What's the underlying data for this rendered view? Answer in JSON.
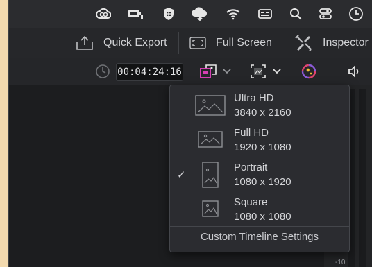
{
  "toolbar": {
    "quick_export": "Quick Export",
    "full_screen": "Full Screen",
    "inspector": "Inspector"
  },
  "viewer": {
    "timecode": "00:04:24:16",
    "meter_label": "-10"
  },
  "menu": {
    "items": [
      {
        "name": "Ultra HD",
        "resolution": "3840 x 2160",
        "checked": false
      },
      {
        "name": "Full HD",
        "resolution": "1920 x 1080",
        "checked": false
      },
      {
        "name": "Portrait",
        "resolution": "1080 x 1920",
        "checked": true
      },
      {
        "name": "Square",
        "resolution": "1080 x 1080",
        "checked": false
      }
    ],
    "checkmark": "✓",
    "custom": "Custom Timeline Settings"
  },
  "colors": {
    "accent": "#d63fb4",
    "background": "#232426",
    "text": "#d4d5d8"
  }
}
